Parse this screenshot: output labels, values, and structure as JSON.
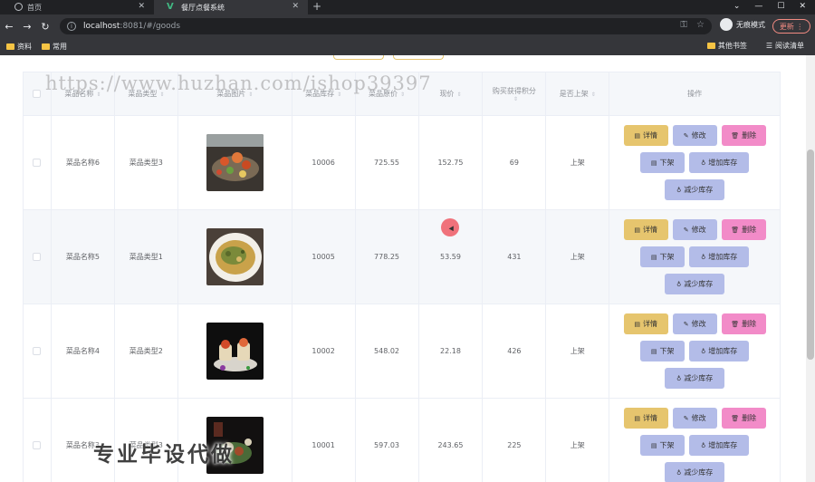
{
  "browser": {
    "tabs": [
      {
        "label": "首页",
        "icon": "globe-icon"
      },
      {
        "label": "餐厅点餐系统",
        "icon": "vue-logo-icon"
      }
    ],
    "url_host": "localhost",
    "url_path": ":8081/#/goods",
    "profile_label": "无痕模式",
    "update_label": "更新",
    "bookmarks": [
      "资料",
      "常用"
    ],
    "bookmarks_right": [
      "其他书签",
      "阅读清单"
    ]
  },
  "table": {
    "headers": {
      "name": "菜品名称",
      "type": "菜品类型",
      "image": "菜品图片",
      "stock": "菜品库存",
      "price": "菜品原价",
      "current_price": "现价",
      "points": "购买获得积分",
      "on_sale": "是否上架",
      "actions": "操作"
    },
    "rows": [
      {
        "name": "菜品名称6",
        "type": "菜品类型3",
        "stock": "10006",
        "price": "725.55",
        "current_price": "152.75",
        "points": "69",
        "on_sale": "上架"
      },
      {
        "name": "菜品名称5",
        "type": "菜品类型1",
        "stock": "10005",
        "price": "778.25",
        "current_price": "53.59",
        "points": "431",
        "on_sale": "上架"
      },
      {
        "name": "菜品名称4",
        "type": "菜品类型2",
        "stock": "10002",
        "price": "548.02",
        "current_price": "22.18",
        "points": "426",
        "on_sale": "上架"
      },
      {
        "name": "菜品名称3",
        "type": "菜品类型3",
        "stock": "10001",
        "price": "597.03",
        "current_price": "243.65",
        "points": "225",
        "on_sale": "上架"
      }
    ],
    "actions": {
      "detail": "详情",
      "edit": "修改",
      "delete": "删除",
      "off_shelf": "下架",
      "increase_stock": "增加库存",
      "decrease_stock": "减少库存"
    }
  },
  "watermarks": {
    "url": "https://www.huzhan.com/ishop39397",
    "caption": "专业毕设代做"
  }
}
